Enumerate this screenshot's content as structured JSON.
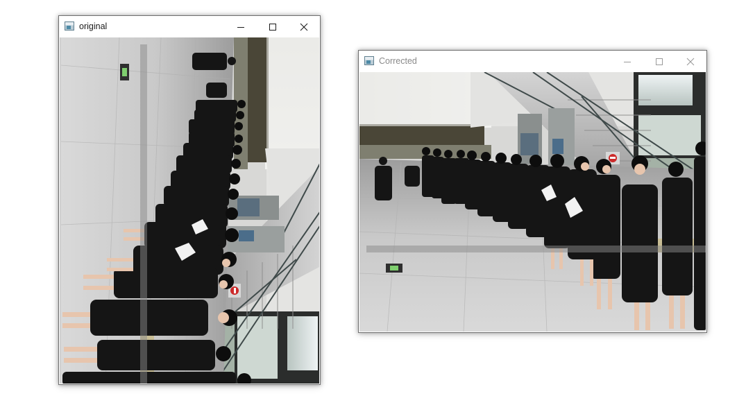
{
  "windows": {
    "original": {
      "title": "original",
      "icon": "image-window-icon",
      "state": "active",
      "image": "rotated-photo-queue-of-women-in-black-suits"
    },
    "corrected": {
      "title": "Corrected",
      "icon": "image-window-icon",
      "state": "inactive",
      "image": "upright-photo-queue-of-women-in-black-suits"
    }
  },
  "controls": {
    "minimize_icon": "minimize-icon",
    "maximize_icon": "maximize-icon",
    "close_icon": "close-icon"
  },
  "colors": {
    "window_border": "#6f6f6f",
    "title_active": "#1a1a1a",
    "title_inactive": "#8a8a8a",
    "floor": "#bfbfbf",
    "suit": "#151515"
  }
}
